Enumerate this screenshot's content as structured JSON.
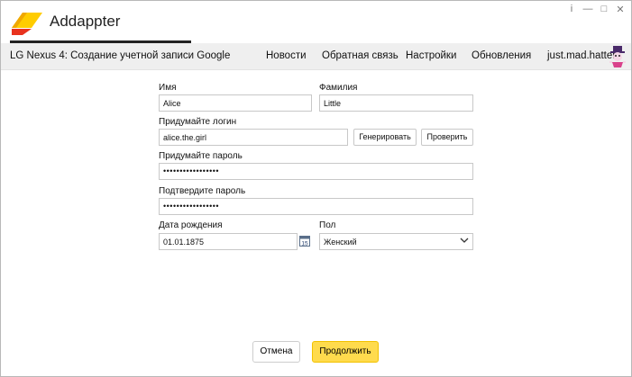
{
  "app": {
    "title": "Addappter"
  },
  "window_controls": {
    "info": "i",
    "minimize": "—",
    "maximize": "□",
    "close": "✕"
  },
  "nav": {
    "page_title": "LG Nexus 4: Создание учетной записи Google",
    "items": [
      "Новости",
      "Обратная связь",
      "Настройки",
      "Обновления"
    ],
    "user": "just.mad.hatter"
  },
  "form": {
    "first_name": {
      "label": "Имя",
      "value": "Alice"
    },
    "last_name": {
      "label": "Фамилия",
      "value": "Little"
    },
    "login": {
      "label": "Придумайте логин",
      "value": "alice.the.girl",
      "generate_label": "Генерировать",
      "check_label": "Проверить"
    },
    "password": {
      "label": "Придумайте пароль",
      "value": "•••••••••••••••••"
    },
    "password_confirm": {
      "label": "Подтвердите пароль",
      "value": "•••••••••••••••••"
    },
    "birth_date": {
      "label": "Дата рождения",
      "value": "01.01.1875",
      "calendar_day": "15"
    },
    "gender": {
      "label": "Пол",
      "value": "Женский"
    }
  },
  "footer": {
    "cancel_label": "Отмена",
    "continue_label": "Продолжить"
  },
  "colors": {
    "accent": "#ffdb4d",
    "logo_yellow": "#ffcc00",
    "logo_red": "#e8321e"
  }
}
